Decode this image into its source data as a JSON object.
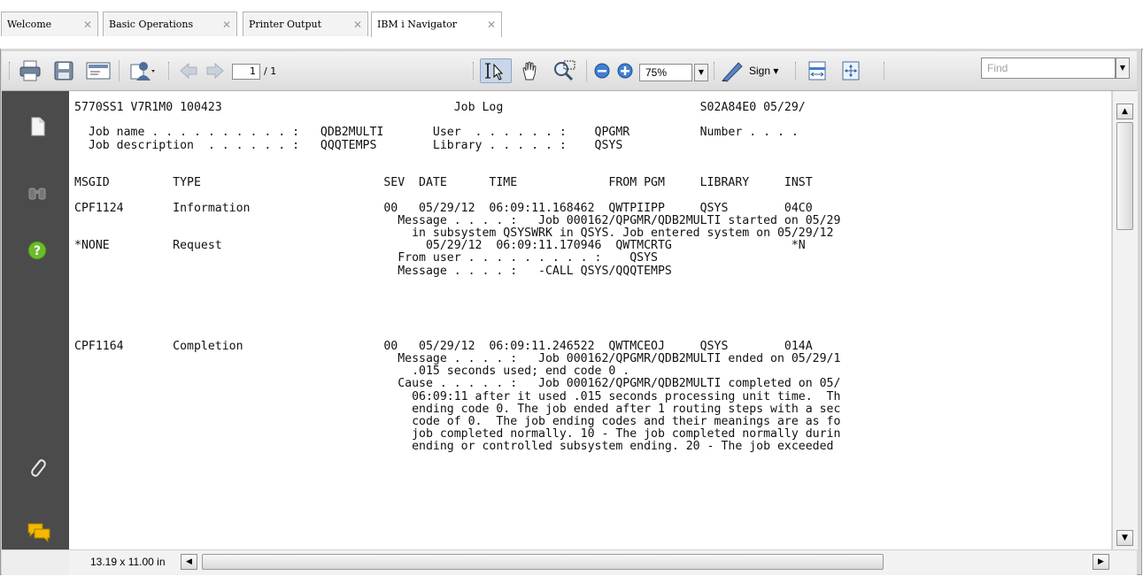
{
  "tabs": [
    {
      "label": "Welcome",
      "active": false
    },
    {
      "label": "Basic Operations",
      "active": false
    },
    {
      "label": "Printer Output",
      "active": false
    },
    {
      "label": "IBM i Navigator",
      "active": true
    }
  ],
  "toolbar": {
    "page_number": "1",
    "page_total": "/ 1",
    "zoom": "75%",
    "sign_label": "Sign ▾",
    "find_placeholder": "Find",
    "icons": [
      "print-icon",
      "save-icon",
      "email-icon",
      "user-icon",
      "previous-page-icon",
      "next-page-icon",
      "select-tool-icon",
      "hand-tool-icon",
      "marquee-zoom-icon",
      "zoom-out-icon",
      "zoom-in-icon",
      "sign-pen-icon",
      "fit-width-icon",
      "fit-page-icon"
    ]
  },
  "left_rail": {
    "icons": [
      "pages-icon",
      "binoculars-icon",
      "help-icon",
      "attachment-icon",
      "comments-icon"
    ]
  },
  "status": {
    "page_size": "13.19 x 11.00 in"
  },
  "document": {
    "lines": [
      "5770SS1 V7R1M0 100423                                 Job Log                            S02A84E0 05/29/",
      "",
      "  Job name . . . . . . . . . . :   QDB2MULTI       User  . . . . . . :    QPGMR          Number . . . .",
      "  Job description  . . . . . . :   QQQTEMPS        Library . . . . . :    QSYS",
      "",
      "",
      "MSGID         TYPE                          SEV  DATE      TIME             FROM PGM     LIBRARY     INST",
      "",
      "CPF1124       Information                   00   05/29/12  06:09:11.168462  QWTPIIPP     QSYS        04C0",
      "                                              Message . . . . :   Job 000162/QPGMR/QDB2MULTI started on 05/29",
      "                                                in subsystem QSYSWRK in QSYS. Job entered system on 05/29/12",
      "*NONE         Request                             05/29/12  06:09:11.170946  QWTMCRTG                 *N",
      "                                              From user . . . . . . . . . :    QSYS",
      "                                              Message . . . . :   -CALL QSYS/QQQTEMPS",
      "",
      "",
      "",
      "",
      "",
      "CPF1164       Completion                    00   05/29/12  06:09:11.246522  QWTMCEOJ     QSYS        014A",
      "                                              Message . . . . :   Job 000162/QPGMR/QDB2MULTI ended on 05/29/1",
      "                                                .015 seconds used; end code 0 .",
      "                                              Cause . . . . . :   Job 000162/QPGMR/QDB2MULTI completed on 05/",
      "                                                06:09:11 after it used .015 seconds processing unit time.  Th",
      "                                                ending code 0. The job ended after 1 routing steps with a sec",
      "                                                code of 0.  The job ending codes and their meanings are as fo",
      "                                                job completed normally. 10 - The job completed normally durin",
      "                                                ending or controlled subsystem ending. 20 - The job exceeded"
    ]
  }
}
